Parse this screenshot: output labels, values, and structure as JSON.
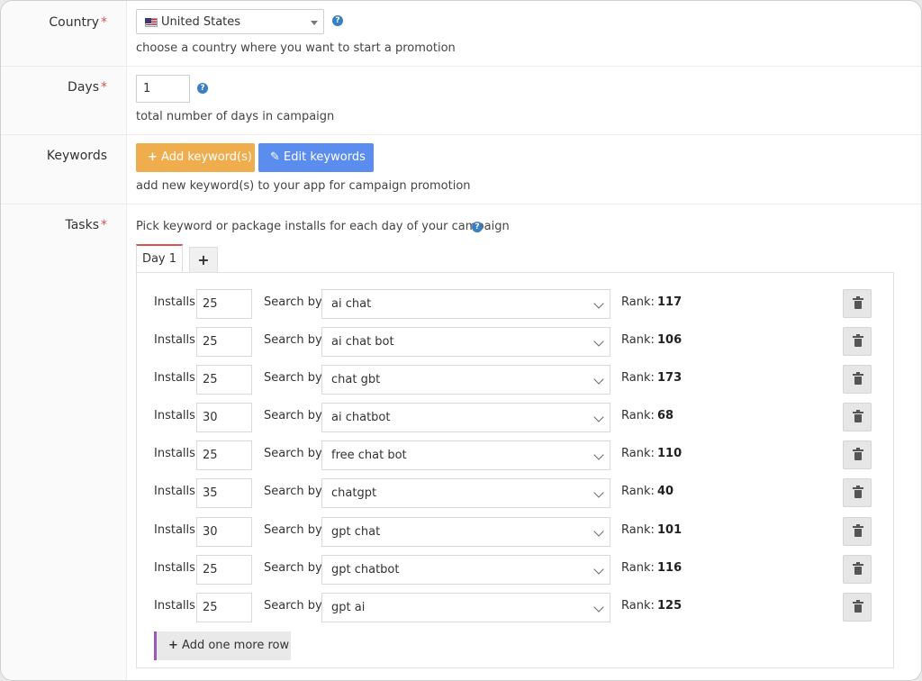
{
  "fields": {
    "country": {
      "label": "Country",
      "required_mark": "*",
      "value": "United States",
      "hint": "choose a country where you want to start a promotion"
    },
    "days": {
      "label": "Days",
      "required_mark": "*",
      "value": "1",
      "hint": "total number of days in campaign"
    },
    "keywords": {
      "label": "Keywords",
      "add_button": "Add keyword(s)",
      "edit_button": "Edit keywords",
      "hint": "add new keyword(s) to your app for campaign promotion"
    },
    "tasks": {
      "label": "Tasks",
      "required_mark": "*",
      "hint": "Pick keyword or package installs for each day of your campaign"
    }
  },
  "help_icon": "?",
  "tabs": {
    "active": "Day 1",
    "add": "+"
  },
  "row_labels": {
    "installs": "Installs",
    "search_by": "Search by",
    "rank": "Rank:"
  },
  "rows": [
    {
      "installs": "25",
      "keyword": "ai chat",
      "rank": "117"
    },
    {
      "installs": "25",
      "keyword": "ai chat bot",
      "rank": "106"
    },
    {
      "installs": "25",
      "keyword": "chat gbt",
      "rank": "173"
    },
    {
      "installs": "30",
      "keyword": "ai chatbot",
      "rank": "68"
    },
    {
      "installs": "25",
      "keyword": "free chat bot",
      "rank": "110"
    },
    {
      "installs": "35",
      "keyword": "chatgpt",
      "rank": "40"
    },
    {
      "installs": "30",
      "keyword": "gpt chat",
      "rank": "101"
    },
    {
      "installs": "25",
      "keyword": "gpt chatbot",
      "rank": "116"
    },
    {
      "installs": "25",
      "keyword": "gpt ai",
      "rank": "125"
    }
  ],
  "add_row_button": "Add one more row",
  "icons": {
    "add": "plus-icon",
    "edit": "edit-icon",
    "delete": "trash-icon",
    "help": "question-circle-icon"
  },
  "colors": {
    "add_button": "#f0ad4e",
    "edit_button": "#5b8def",
    "required": "#d9534f",
    "help": "#3a7fc1"
  }
}
